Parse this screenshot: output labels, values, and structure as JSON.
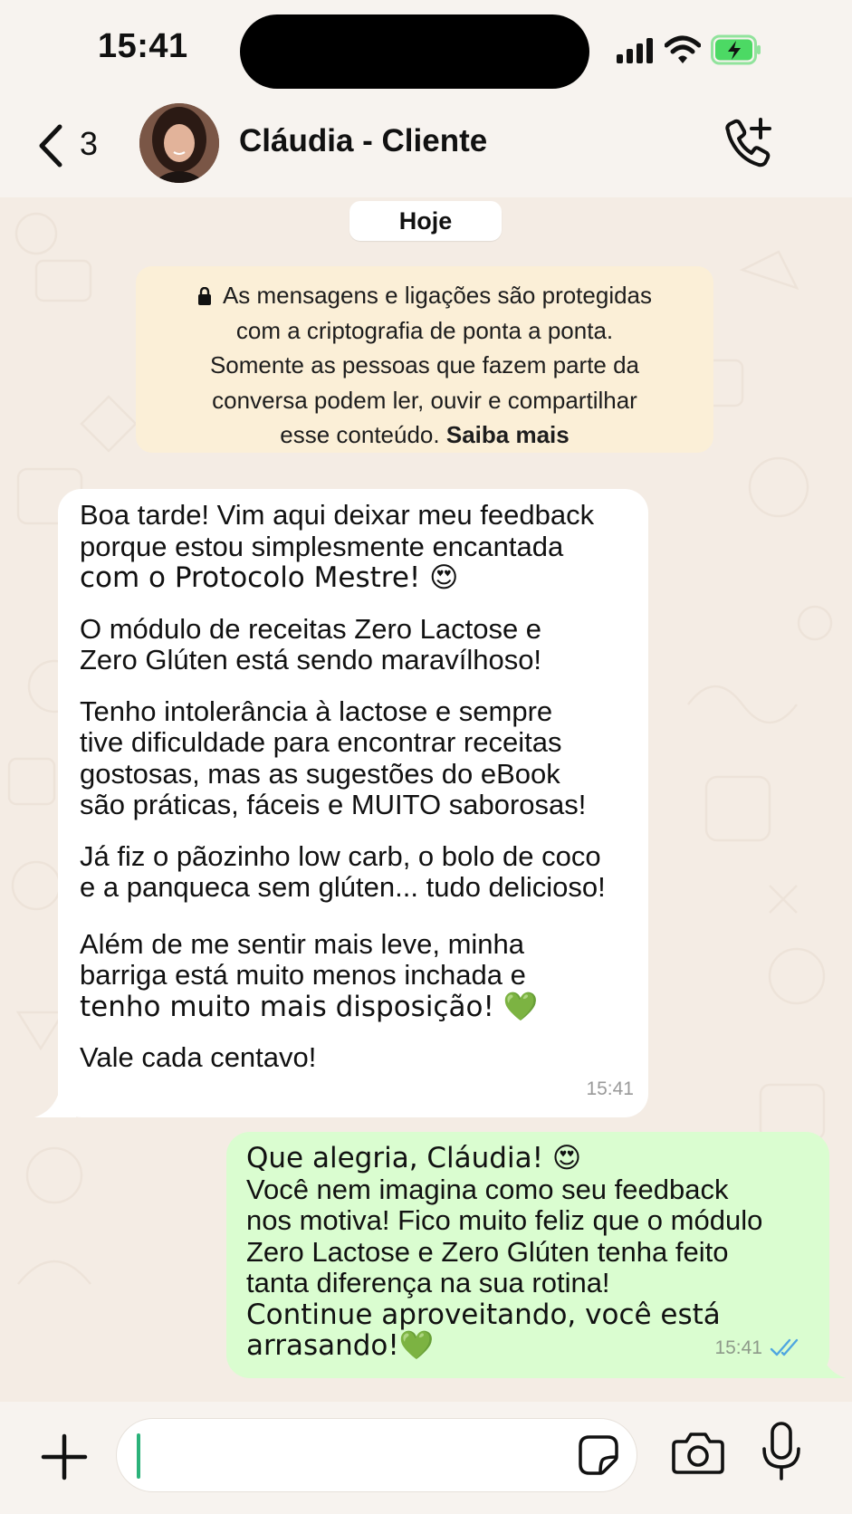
{
  "status_bar": {
    "time": "15:41"
  },
  "header": {
    "back_count": "3",
    "contact_name": "Cláudia - Cliente"
  },
  "chat": {
    "date_chip": "Hoje",
    "encryption_notice": {
      "line1": "As mensagens e ligações são protegidas",
      "line2": "com a criptografia de ponta a ponta.",
      "line3": "Somente as pessoas que fazem parte da",
      "line4": "conversa podem ler, ouvir e compartilhar",
      "line5": "esse conteúdo.",
      "link": "Saiba mais"
    },
    "incoming": {
      "paragraphs": [
        [
          "Boa tarde! Vim aqui deixar meu feedback",
          "porque estou simplesmente encantada",
          "com o Protocolo Mestre! 😍"
        ],
        [
          "O módulo de receitas Zero Lactose e",
          "Zero Glúten está sendo maravílhoso!"
        ],
        [
          "Tenho intolerância à lactose e sempre",
          "tive dificuldade para encontrar receitas",
          "gostosas, mas as sugestões do eBook",
          "são práticas, fáceis e MUITO saborosas!"
        ],
        [
          "Já fiz o pãozinho low carb, o bolo de coco",
          "e a panqueca sem glúten... tudo delicioso!"
        ],
        [
          "Além de me sentir mais leve, minha",
          "barriga está muito menos inchada e",
          "tenho muito mais disposição! 💚"
        ],
        [
          "Vale cada centavo!"
        ]
      ],
      "time": "15:41"
    },
    "outgoing": {
      "lines": [
        "Que alegria, Cláudia! 😍",
        "Você nem imagina como seu feedback",
        "nos motiva! Fico muito feliz que o módulo",
        "Zero Lactose e Zero Glúten tenha feito",
        "tanta diferença na sua rotina!",
        "Continue aproveitando, você está arrasando!💚"
      ],
      "time": "15:41",
      "status": "read"
    }
  },
  "colors": {
    "incoming_bubble": "#ffffff",
    "outgoing_bubble": "#dafdd0",
    "notice_bg": "#fbefd7",
    "read_ticks": "#4fa6e0",
    "cursor": "#2bb27a",
    "battery": "#4cd964"
  },
  "icons": [
    "back-chevron-icon",
    "add-call-icon",
    "lock-icon",
    "double-check-icon",
    "plus-icon",
    "sticker-icon",
    "camera-icon",
    "microphone-icon",
    "signal-icon",
    "wifi-icon",
    "battery-charging-icon"
  ]
}
